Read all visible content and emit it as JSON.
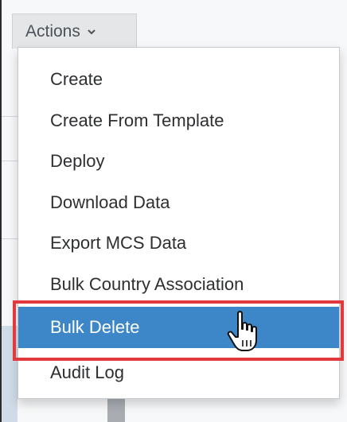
{
  "actions_button": {
    "label": "Actions",
    "icon": "chevron-down-icon"
  },
  "menu": {
    "items": [
      {
        "label": "Create"
      },
      {
        "label": "Create From Template"
      },
      {
        "label": "Deploy"
      },
      {
        "label": "Download Data"
      },
      {
        "label": "Export MCS Data"
      },
      {
        "label": "Bulk Country Association"
      },
      {
        "label": "Bulk Delete",
        "state": "hovered"
      },
      {
        "label": "Audit Log"
      }
    ]
  },
  "colors": {
    "hover_background": "#3d87c8",
    "highlight_border": "#e2393d",
    "button_background": "#e4e6e8"
  },
  "cursor": {
    "icon": "hand-pointer-icon"
  }
}
